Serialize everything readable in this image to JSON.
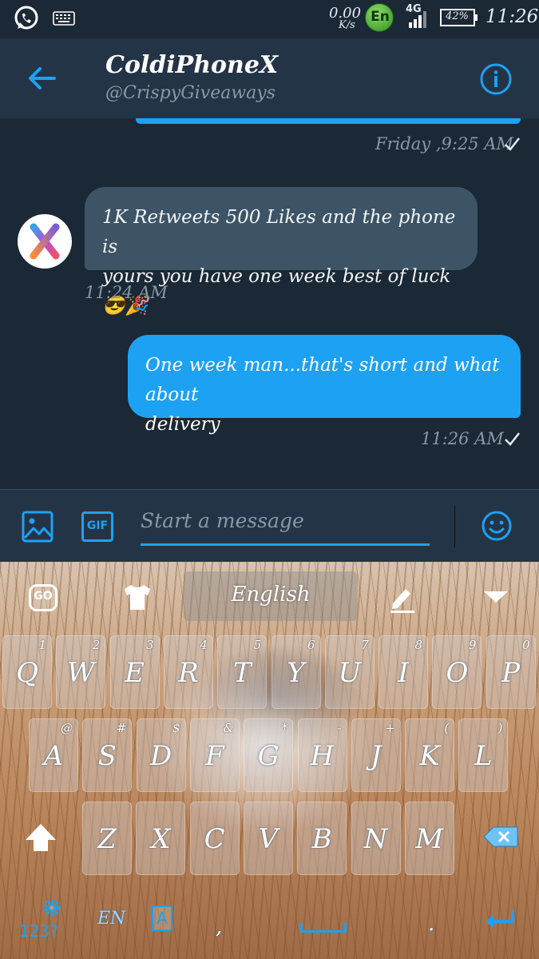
{
  "status_bar": {
    "net_speed_value": "0.00",
    "net_speed_unit": "K/s",
    "ime_badge": "En",
    "network_type": "4G",
    "battery_percent": "42%",
    "time": "11:26",
    "icons": [
      "whatsapp-icon",
      "keyboard-icon",
      "signal-icon",
      "battery-icon"
    ]
  },
  "header": {
    "title": "ColdiPhoneX",
    "handle": "@CrispyGiveaways",
    "icons": [
      "back-arrow-icon",
      "info-icon"
    ]
  },
  "conversation": {
    "messages": [
      {
        "direction": "outgoing",
        "timestamp": "Friday ,9:25 AM",
        "read_check": true
      },
      {
        "direction": "incoming",
        "text_line1": "1K Retweets 500 Likes and the phone is",
        "text_line2": "yours you have one week best of luck😎🎉",
        "timestamp": "11:24 AM"
      },
      {
        "direction": "outgoing",
        "text_line1": "One week man...that's short and what about",
        "text_line2": "delivery",
        "timestamp": "11:26 AM",
        "read_check": true
      }
    ]
  },
  "composer": {
    "placeholder": "Start a message",
    "gif_label": "GIF",
    "icons": [
      "image-icon",
      "gif-icon",
      "emoji-icon"
    ]
  },
  "keyboard": {
    "go_label": "GO",
    "language": "English",
    "rows": [
      [
        {
          "main": "Q",
          "sub": "1"
        },
        {
          "main": "W",
          "sub": "2"
        },
        {
          "main": "E",
          "sub": "3"
        },
        {
          "main": "R",
          "sub": "4"
        },
        {
          "main": "T",
          "sub": "5"
        },
        {
          "main": "Y",
          "sub": "6"
        },
        {
          "main": "U",
          "sub": "7"
        },
        {
          "main": "I",
          "sub": "8"
        },
        {
          "main": "O",
          "sub": "9"
        },
        {
          "main": "P",
          "sub": "0"
        }
      ],
      [
        {
          "main": "A",
          "sub": "@"
        },
        {
          "main": "S",
          "sub": "#"
        },
        {
          "main": "D",
          "sub": "$"
        },
        {
          "main": "F",
          "sub": "&"
        },
        {
          "main": "G",
          "sub": "*"
        },
        {
          "main": "H",
          "sub": "-"
        },
        {
          "main": "J",
          "sub": "+"
        },
        {
          "main": "K",
          "sub": "("
        },
        {
          "main": "L",
          "sub": ")"
        }
      ],
      [
        {
          "main": "Z",
          "sub": ""
        },
        {
          "main": "X",
          "sub": ""
        },
        {
          "main": "C",
          "sub": ""
        },
        {
          "main": "V",
          "sub": ""
        },
        {
          "main": "B",
          "sub": ""
        },
        {
          "main": "N",
          "sub": ""
        },
        {
          "main": "M",
          "sub": ""
        }
      ]
    ],
    "bottom_row": {
      "symbols_label": "123?",
      "lang_switch_label": "EN",
      "font_key_label": "A",
      "comma": ",",
      "period": "."
    },
    "icons": [
      "go-icon",
      "theme-shirt-icon",
      "edit-icon",
      "collapse-chevron-icon",
      "shift-icon",
      "backspace-icon",
      "settings-gear-icon",
      "font-icon",
      "space-icon",
      "enter-icon"
    ]
  }
}
